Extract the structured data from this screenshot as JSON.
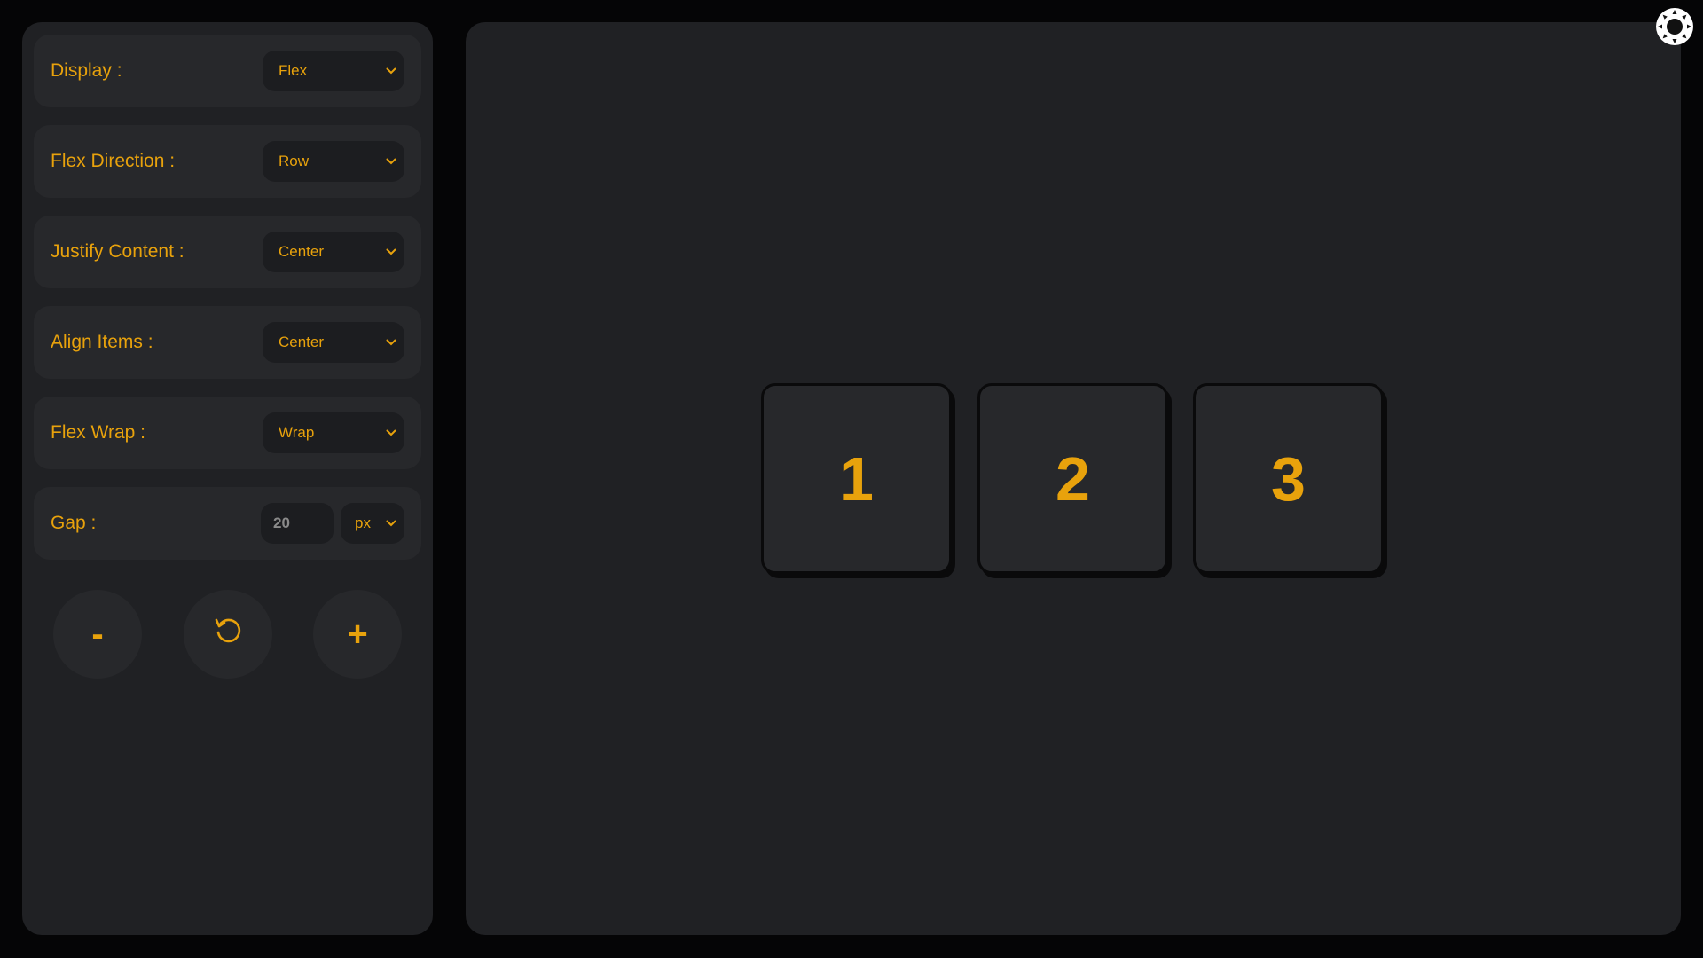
{
  "controls": {
    "display": {
      "label": "Display :",
      "value": "Flex"
    },
    "flex_direction": {
      "label": "Flex Direction :",
      "value": "Row"
    },
    "justify_content": {
      "label": "Justify Content :",
      "value": "Center"
    },
    "align_items": {
      "label": "Align Items :",
      "value": "Center"
    },
    "flex_wrap": {
      "label": "Flex Wrap :",
      "value": "Wrap"
    },
    "gap": {
      "label": "Gap :",
      "value": "20",
      "unit": "px"
    }
  },
  "buttons": {
    "remove": "-",
    "reset_icon": "rotate-ccw-icon",
    "add": "+"
  },
  "items": [
    "1",
    "2",
    "3"
  ],
  "theme_toggle_icon": "sun-icon",
  "colors": {
    "accent": "#e8a20c",
    "panel": "#202124",
    "card": "#27282b",
    "background": "#050506"
  }
}
